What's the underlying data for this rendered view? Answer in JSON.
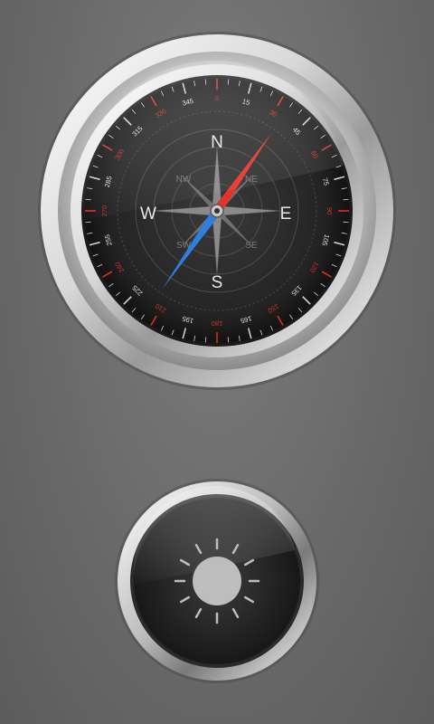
{
  "compass": {
    "cardinals": {
      "north": "N",
      "east": "E",
      "south": "S",
      "west": "W"
    },
    "intercardinals": {
      "nw": "NW",
      "ne": "NE",
      "sw": "SW",
      "se": "SE"
    },
    "degree_labels": [
      "345",
      "15",
      "45",
      "75",
      "105",
      "135",
      "165",
      "195",
      "225",
      "255",
      "285",
      "315"
    ],
    "red_degree_labels": [
      "0",
      "30",
      "60",
      "90",
      "120",
      "150",
      "180",
      "210",
      "240",
      "270",
      "300",
      "330"
    ],
    "heading_degrees": 35,
    "needle_north_color": "#e3342a",
    "needle_south_color": "#2f7fe0"
  },
  "flashlight": {
    "icon": "sun-icon"
  }
}
